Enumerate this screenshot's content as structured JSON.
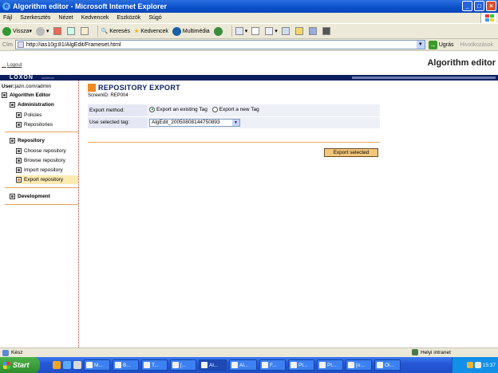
{
  "window": {
    "title": "Algorithm editor - Microsoft Internet Explorer"
  },
  "menu": [
    "Fájl",
    "Szerkesztés",
    "Nézet",
    "Kedvencek",
    "Eszközök",
    "Súgó"
  ],
  "toolbar": {
    "back": "Vissza",
    "search": "Keresés",
    "favorites": "Kedvencek",
    "media": "Multimédia"
  },
  "address": {
    "label": "Cím",
    "url": "http://ias10g:81/AlgEdit/Frameset.html",
    "go": "Ugrás",
    "links": "Hivatkozások"
  },
  "app": {
    "logout": "Logout",
    "title": "Algorithm editor",
    "logo": "LOXON",
    "logo_sub": "solutions"
  },
  "sidebar": {
    "user_label": "User:",
    "user": "jazn.com/admin",
    "root": "Algorithm Editor",
    "admin_section": "Administration",
    "admin_items": [
      "Policies",
      "Repositories"
    ],
    "repo_section": "Repository",
    "repo_items": [
      "Choose repository",
      "Browse repository",
      "Import repository",
      "Export repository"
    ],
    "dev_section": "Development"
  },
  "page": {
    "title": "REPOSITORY EXPORT",
    "screen_id": "ScreenID: REP004",
    "export_method_label": "Export method:",
    "option_existing": "Export an existing Tag",
    "option_new": "Export a new Tag",
    "selected_option": "existing",
    "use_tag_label": "Use selected tag:",
    "selected_tag": "AlgEdit_20050808144750893",
    "export_button": "Export selected"
  },
  "status": {
    "text": "Kész",
    "zone": "Helyi intranet"
  },
  "taskbar": {
    "start": "Start",
    "tasks": [
      "M...",
      "B...",
      "T...",
      "[...",
      "Al...",
      "Al...",
      "F...",
      "Pl...",
      "Pl...",
      "[o...",
      "Ol..."
    ],
    "clock": "15:37"
  },
  "colors": {
    "accent_orange": "#f08a24",
    "banner_navy": "#0b1f5c",
    "xp_blue": "#0a4fc9"
  }
}
